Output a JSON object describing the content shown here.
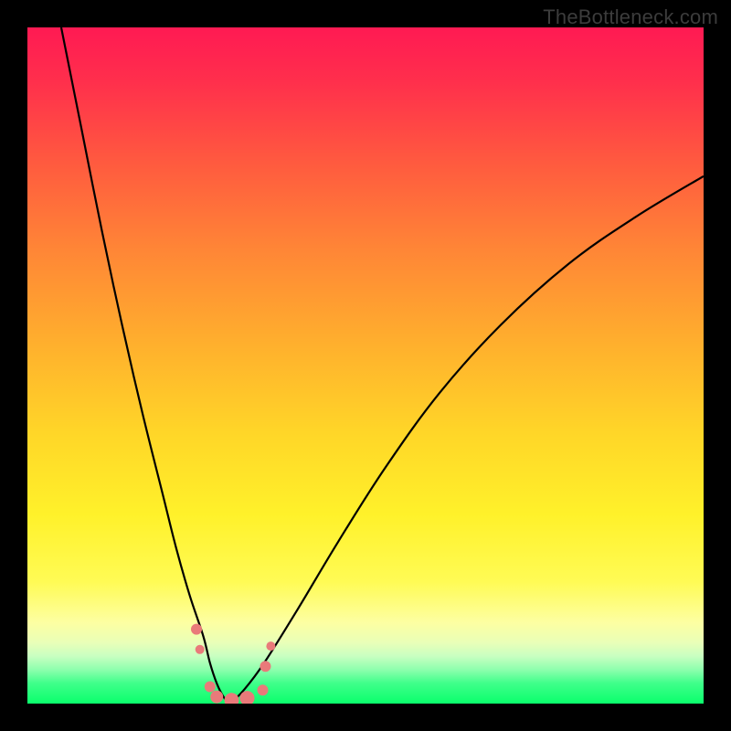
{
  "watermark": {
    "text": "TheBottleneck.com"
  },
  "colors": {
    "page_bg": "#000000",
    "curve_stroke": "#000000",
    "marker_fill": "#e97a7a",
    "marker_stroke": "#d66060",
    "watermark": "#3c3c3c"
  },
  "chart_data": {
    "type": "line",
    "title": "",
    "xlabel": "",
    "ylabel": "",
    "xlim": [
      0,
      100
    ],
    "ylim": [
      0,
      100
    ],
    "grid": false,
    "legend": false,
    "background": "rainbow-gradient",
    "series": [
      {
        "name": "left-branch",
        "x": [
          5,
          8,
          11,
          14,
          17,
          20,
          22,
          24,
          26,
          27,
          28,
          29,
          30
        ],
        "values": [
          100,
          85,
          70,
          56,
          43,
          31,
          23,
          16,
          10,
          6,
          3,
          1,
          0
        ]
      },
      {
        "name": "right-branch",
        "x": [
          30,
          32,
          35,
          40,
          46,
          53,
          61,
          70,
          80,
          90,
          100
        ],
        "values": [
          0,
          2,
          6,
          14,
          24,
          35,
          46,
          56,
          65,
          72,
          78
        ]
      }
    ],
    "markers": [
      {
        "x": 25.0,
        "y": 11.0
      },
      {
        "x": 25.5,
        "y": 8.0
      },
      {
        "x": 27.0,
        "y": 2.5
      },
      {
        "x": 28.0,
        "y": 1.0
      },
      {
        "x": 30.2,
        "y": 0.5
      },
      {
        "x": 32.5,
        "y": 0.8
      },
      {
        "x": 34.8,
        "y": 2.0
      },
      {
        "x": 35.2,
        "y": 5.5
      },
      {
        "x": 36.0,
        "y": 8.5
      }
    ],
    "marker_radii": [
      6,
      5,
      6,
      7,
      8,
      8,
      6,
      6,
      5
    ]
  }
}
